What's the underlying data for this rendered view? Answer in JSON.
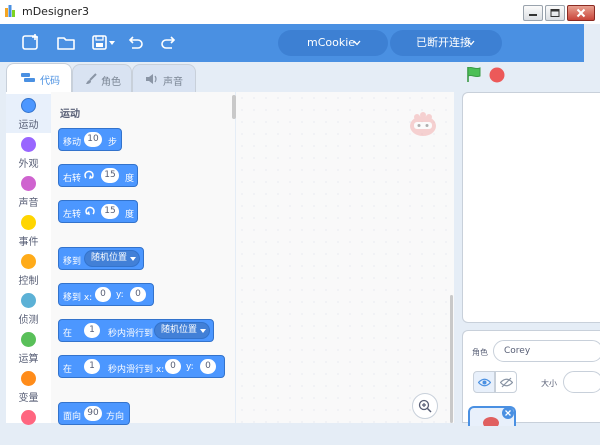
{
  "window": {
    "title": "mDesigner3"
  },
  "menubar": {
    "device_label": "mCookie",
    "connection_label": "已断开连接"
  },
  "tabs": [
    {
      "label": "代码"
    },
    {
      "label": "角色"
    },
    {
      "label": "声音"
    }
  ],
  "categories": [
    {
      "label": "运动",
      "color": "#4c97ff"
    },
    {
      "label": "外观",
      "color": "#9966ff"
    },
    {
      "label": "声音",
      "color": "#cf63cf"
    },
    {
      "label": "事件",
      "color": "#ffd500"
    },
    {
      "label": "控制",
      "color": "#ffab19"
    },
    {
      "label": "侦测",
      "color": "#5cb1d6"
    },
    {
      "label": "运算",
      "color": "#59c059"
    },
    {
      "label": "变量",
      "color": "#ff8c1a"
    },
    {
      "label": "",
      "color": "#ff6680"
    }
  ],
  "palette": {
    "heading": "运动",
    "blocks": {
      "move": {
        "label": "移动",
        "value": "10",
        "suffix": "步"
      },
      "turn_right": {
        "label": "右转",
        "value": "15",
        "suffix": "度"
      },
      "turn_left": {
        "label": "左转",
        "value": "15",
        "suffix": "度"
      },
      "goto": {
        "label": "移到",
        "dropdown": "随机位置"
      },
      "goto_xy": {
        "label": "移到 x:",
        "x": "0",
        "y_label": "y:",
        "y": "0"
      },
      "glide": {
        "label": "在",
        "secs": "1",
        "mid": "秒内滑行到",
        "dropdown": "随机位置"
      },
      "glide_xy": {
        "label": "在",
        "secs": "1",
        "mid": "秒内滑行到 x:",
        "x": "0",
        "y_label": "y:",
        "y": "0"
      },
      "point": {
        "label": "面向",
        "value": "90",
        "suffix": "方向"
      }
    }
  },
  "sprite_panel": {
    "sprite_label": "角色",
    "sprite_name": "Corey",
    "size_label": "大小"
  },
  "colors": {
    "accent": "#4a90e2",
    "motion": "#4c97ff",
    "flag": "#4cbf56",
    "stop": "#ec5959"
  }
}
